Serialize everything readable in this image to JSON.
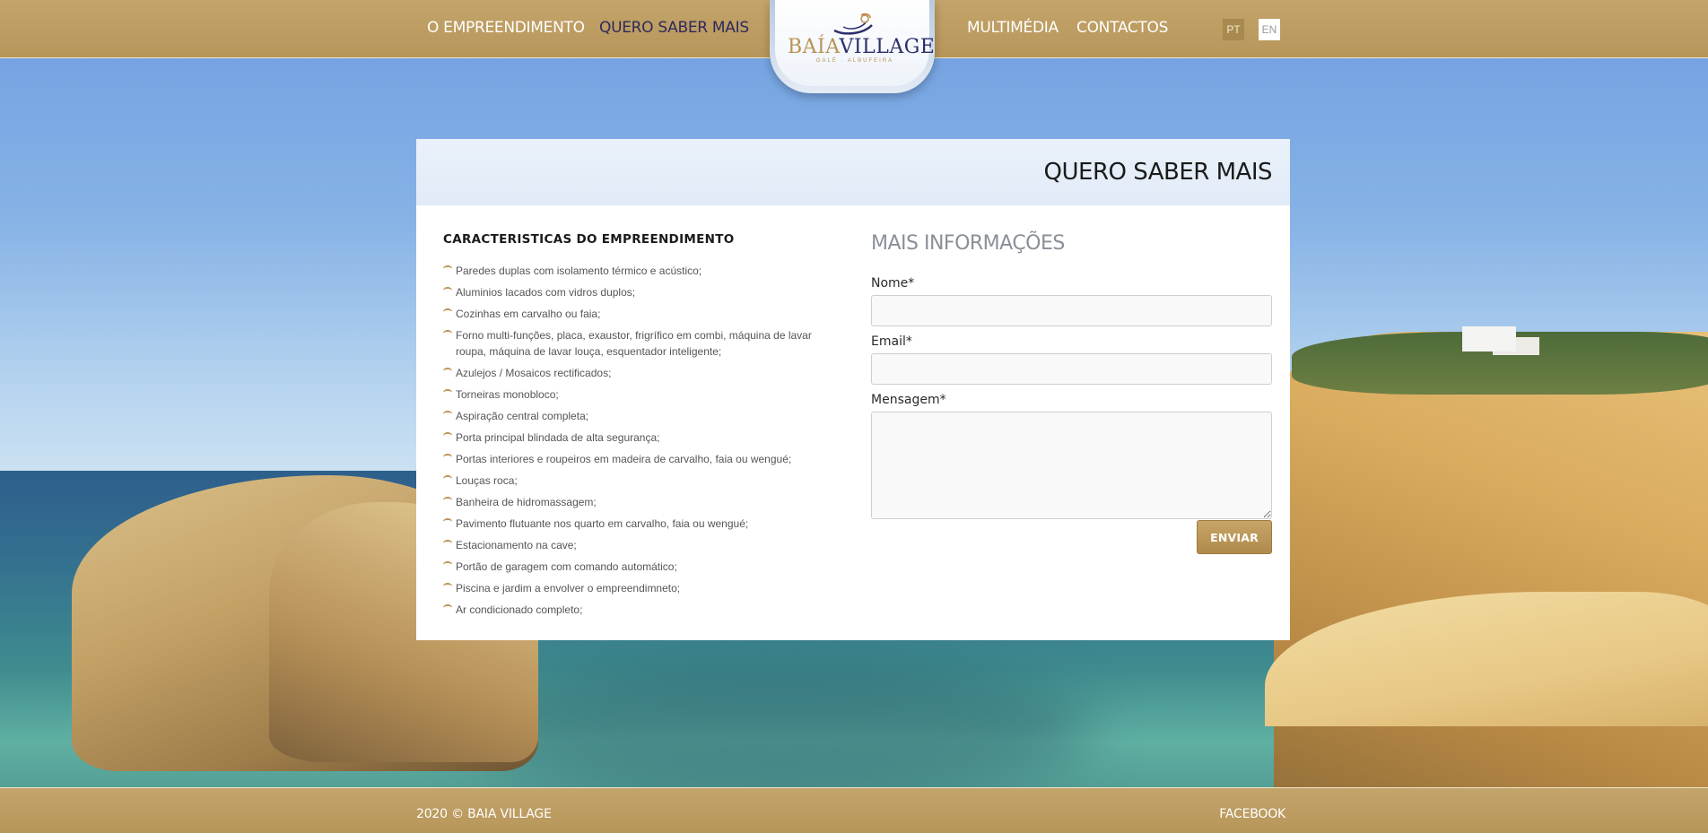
{
  "nav": {
    "left": [
      {
        "label": "O EMPREENDIMENTO"
      },
      {
        "label": "QUERO SABER MAIS"
      }
    ],
    "right": [
      {
        "label": "MULTIMÉDIA"
      },
      {
        "label": "CONTACTOS"
      }
    ],
    "languages": [
      {
        "label": "PT"
      },
      {
        "label": "EN"
      }
    ],
    "active": "QUERO SABER MAIS"
  },
  "logo": {
    "word_baia": "BAÍA",
    "word_village": "VILLAGE",
    "subtitle": "GALÉ · ALBUFEIRA"
  },
  "panel": {
    "title": "QUERO SABER MAIS",
    "features_title": "CARACTERISTICAS DO EMPREENDIMENTO",
    "features": [
      "Paredes duplas com isolamento térmico e acústico;",
      "Aluminios lacados com vidros duplos;",
      "Cozinhas em carvalho ou faia;",
      "Forno multi-funções, placa, exaustor, frigrífico em combi, máquina de lavar roupa, máquina de lavar louça, esquentador inteligente;",
      "Azulejos / Mosaicos rectificados;",
      "Torneiras monobloco;",
      "Aspiração central completa;",
      "Porta principal blindada de alta segurança;",
      "Portas interiores e roupeiros em madeira de carvalho, faia ou wengué;",
      "Louças roca;",
      "Banheira de hidromassagem;",
      "Pavimento flutuante nos quarto em carvalho, faia ou wengué;",
      "Estacionamento na cave;",
      "Portão de garagem com comando automático;",
      "Piscina e jardim a envolver o empreendimneto;",
      "Ar condicionado completo;"
    ]
  },
  "form": {
    "title": "MAIS INFORMAÇÕES",
    "name_label": "Nome*",
    "email_label": "Email*",
    "message_label": "Mensagem*",
    "name_value": "",
    "email_value": "",
    "message_value": "",
    "submit_label": "ENVIAR"
  },
  "footer": {
    "copyright": "2020 © BAIA VILLAGE",
    "facebook": "FACEBOOK"
  },
  "colors": {
    "gold": "#b99355",
    "navy": "#2c2f6b",
    "header_bg": "#bb9b5f"
  }
}
